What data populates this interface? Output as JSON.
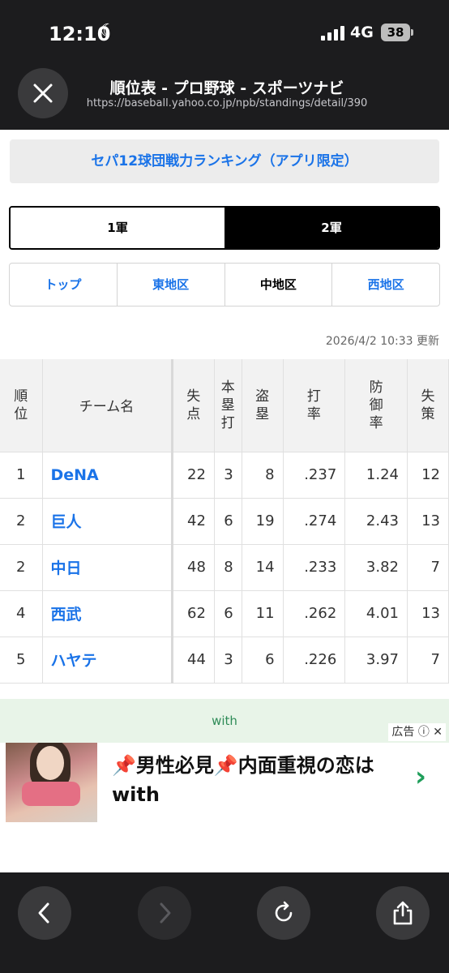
{
  "status_bar": {
    "time": "12:10",
    "network": "4G",
    "battery": "38"
  },
  "browser": {
    "title": "順位表 - プロ野球 - スポーツナビ",
    "url": "https://baseball.yahoo.co.jp/npb/standings/detail/390"
  },
  "banner": {
    "label": "セパ12球団戦力ランキング（アプリ限定）"
  },
  "tier_toggle": {
    "first": "1軍",
    "second": "2軍",
    "selected": "2軍"
  },
  "region_tabs": [
    "トップ",
    "東地区",
    "中地区",
    "西地区"
  ],
  "region_selected": "中地区",
  "updated": "2026/4/2 10:33 更新",
  "table": {
    "headers": [
      "順位",
      "チーム名",
      "失点",
      "本塁打",
      "盗塁",
      "打率",
      "防御率",
      "失策"
    ],
    "rows": [
      {
        "rank": "1",
        "team": "DeNA",
        "runs_allowed": "22",
        "hr": "3",
        "sb": "8",
        "avg": ".237",
        "era": "1.24",
        "errors": "12"
      },
      {
        "rank": "2",
        "team": "巨人",
        "runs_allowed": "42",
        "hr": "6",
        "sb": "19",
        "avg": ".274",
        "era": "2.43",
        "errors": "13"
      },
      {
        "rank": "2",
        "team": "中日",
        "runs_allowed": "48",
        "hr": "8",
        "sb": "14",
        "avg": ".233",
        "era": "3.82",
        "errors": "7"
      },
      {
        "rank": "4",
        "team": "西武",
        "runs_allowed": "62",
        "hr": "6",
        "sb": "11",
        "avg": ".262",
        "era": "4.01",
        "errors": "13"
      },
      {
        "rank": "5",
        "team": "ハヤテ",
        "runs_allowed": "44",
        "hr": "3",
        "sb": "6",
        "avg": ".226",
        "era": "3.97",
        "errors": "7"
      }
    ]
  },
  "ad": {
    "thumb_logo": "with",
    "text": "📌男性必見📌内面重視の恋はwith",
    "footer": "with",
    "label": "広告"
  },
  "colors": {
    "link": "#1a73e8",
    "ad_accent": "#1f9e5a",
    "chrome": "#1c1c1e"
  }
}
